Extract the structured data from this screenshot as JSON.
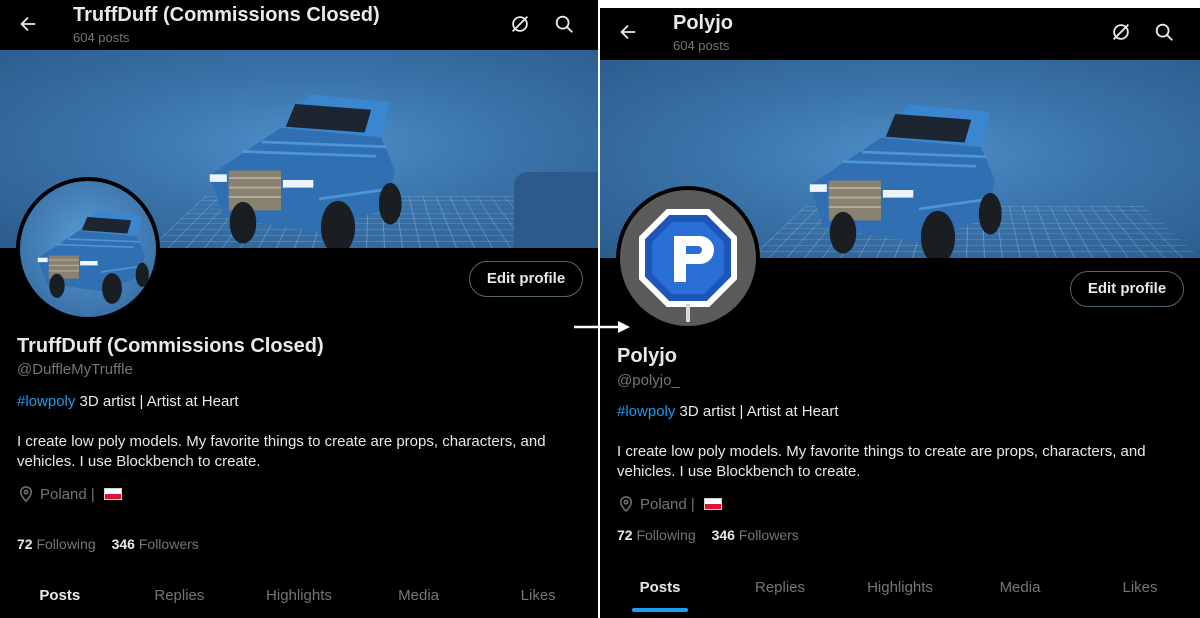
{
  "left": {
    "header_title": "TruffDuff (Commissions Closed)",
    "header_posts": "604 posts",
    "display_name": "TruffDuff (Commissions Closed)",
    "handle": "@DuffleMyTruffle",
    "tagline_hashtag": "#lowpoly",
    "tagline_rest": " 3D artist | Artist at Heart",
    "bio": "I create low poly models. My favorite things to create are props, characters, and vehicles. I use Blockbench to create.",
    "location": "Poland |",
    "following_count": "72",
    "following_label": "Following",
    "followers_count": "346",
    "followers_label": "Followers",
    "edit_profile": "Edit profile",
    "tabs": [
      "Posts",
      "Replies",
      "Highlights",
      "Media",
      "Likes"
    ]
  },
  "right": {
    "header_title": "Polyjo",
    "header_posts": "604 posts",
    "display_name": "Polyjo",
    "handle": "@polyjo_",
    "tagline_hashtag": "#lowpoly",
    "tagline_rest": " 3D artist | Artist at Heart",
    "bio": "I create low poly models. My favorite things to create are props, characters, and vehicles. I use Blockbench to create.",
    "location": "Poland |",
    "following_count": "72",
    "following_label": "Following",
    "followers_count": "346",
    "followers_label": "Followers",
    "edit_profile": "Edit profile",
    "tabs": [
      "Posts",
      "Replies",
      "Highlights",
      "Media",
      "Likes"
    ]
  },
  "icons": {
    "back": "arrow-left-icon",
    "grok": "slashed-circle-icon",
    "search": "search-icon",
    "location": "location-pin-icon",
    "flag": "poland-flag-icon",
    "transition": "arrow-right-icon"
  },
  "colors": {
    "background": "#000000",
    "text_primary": "#e7e9ea",
    "text_secondary": "#71767b",
    "accent": "#1d9bf0"
  },
  "active_tab": "Posts"
}
